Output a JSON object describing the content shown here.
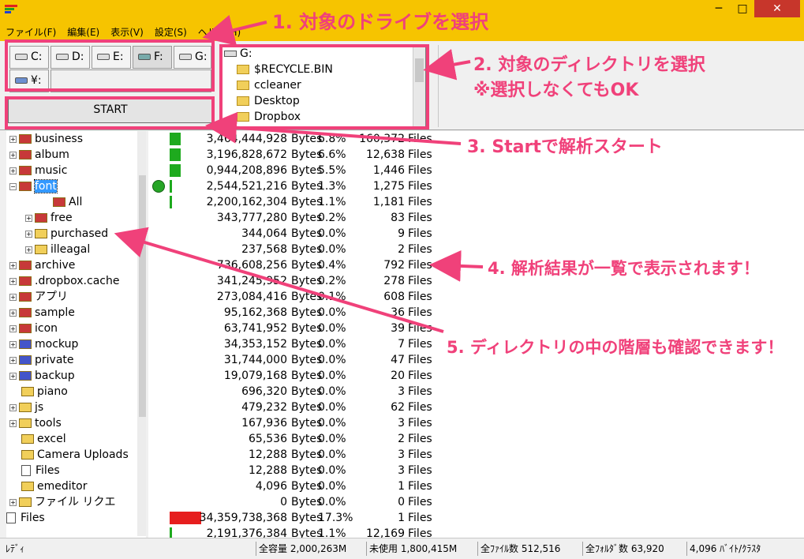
{
  "menu": [
    "ファイル(F)",
    "編集(E)",
    "表示(V)",
    "設定(S)",
    "ヘルプ(H)"
  ],
  "window": {
    "min": "─",
    "max": "□",
    "close": "✕"
  },
  "drives": [
    {
      "label": "C:",
      "icon": "hdd-icon"
    },
    {
      "label": "D:",
      "icon": "hdd-icon"
    },
    {
      "label": "E:",
      "icon": "hdd-icon"
    },
    {
      "label": "F:",
      "icon": "network-drive-icon"
    },
    {
      "label": "G:",
      "icon": "hdd-icon"
    },
    {
      "label": "¥:",
      "icon": "network-computer-icon"
    }
  ],
  "dirs": [
    "G:",
    "$RECYCLE.BIN",
    "ccleaner",
    "Desktop",
    "Dropbox"
  ],
  "start_label": "START",
  "tree": [
    {
      "label": "business",
      "color": "red",
      "depth": 0
    },
    {
      "label": "album",
      "color": "red",
      "depth": 0
    },
    {
      "label": "music",
      "color": "red",
      "depth": 0
    },
    {
      "label": "font",
      "color": "red",
      "depth": 0,
      "selected": true,
      "expanded": true
    },
    {
      "label": "All",
      "color": "red",
      "depth": 2,
      "noexp": true
    },
    {
      "label": "free",
      "color": "red",
      "depth": 1
    },
    {
      "label": "purchased",
      "color": "yel",
      "depth": 1
    },
    {
      "label": "illeagal",
      "color": "yel",
      "depth": 1
    },
    {
      "label": "archive",
      "color": "red",
      "depth": 0
    },
    {
      "label": ".dropbox.cache",
      "color": "red",
      "depth": 0
    },
    {
      "label": "アプリ",
      "color": "red",
      "depth": 0
    },
    {
      "label": "sample",
      "color": "red",
      "depth": 0
    },
    {
      "label": "icon",
      "color": "red",
      "depth": 0
    },
    {
      "label": "mockup",
      "color": "blue",
      "depth": 0
    },
    {
      "label": "private",
      "color": "blue",
      "depth": 0
    },
    {
      "label": "backup",
      "color": "blue",
      "depth": 0
    },
    {
      "label": "piano",
      "color": "yel",
      "depth": 0,
      "noexp": true
    },
    {
      "label": "js",
      "color": "yel",
      "depth": 0
    },
    {
      "label": "tools",
      "color": "yel",
      "depth": 0
    },
    {
      "label": "excel",
      "color": "yel",
      "depth": 0,
      "noexp": true
    },
    {
      "label": "Camera Uploads",
      "color": "yel",
      "depth": 0,
      "noexp": true
    },
    {
      "label": "Files",
      "color": "file",
      "depth": 0,
      "noexp": true
    },
    {
      "label": "emeditor",
      "color": "yel",
      "depth": 0,
      "noexp": true
    },
    {
      "label": "ファイル リクエ",
      "color": "yel",
      "depth": 0
    },
    {
      "label": "Files",
      "color": "file",
      "depth": -1,
      "noexp": true
    }
  ],
  "rows": [
    {
      "bytes": "3,464,444,928",
      "unit": "Bytes",
      "pct": "6.8%",
      "count": "160,372",
      "cunit": "Files"
    },
    {
      "bytes": "3,196,828,672",
      "unit": "Bytes",
      "pct": "6.6%",
      "count": "12,638",
      "cunit": "Files"
    },
    {
      "bytes": "0,944,208,896",
      "unit": "Bytes",
      "pct": "5.5%",
      "count": "1,446",
      "cunit": "Files"
    },
    {
      "bytes": "2,544,521,216",
      "unit": "Bytes",
      "pct": "1.3%",
      "count": "1,275",
      "cunit": "Files"
    },
    {
      "bytes": "2,200,162,304",
      "unit": "Bytes",
      "pct": "1.1%",
      "count": "1,181",
      "cunit": "Files"
    },
    {
      "bytes": "343,777,280",
      "unit": "Bytes",
      "pct": "0.2%",
      "count": "83",
      "cunit": "Files"
    },
    {
      "bytes": "344,064",
      "unit": "Bytes",
      "pct": "0.0%",
      "count": "9",
      "cunit": "Files"
    },
    {
      "bytes": "237,568",
      "unit": "Bytes",
      "pct": "0.0%",
      "count": "2",
      "cunit": "Files"
    },
    {
      "bytes": "736,608,256",
      "unit": "Bytes",
      "pct": "0.4%",
      "count": "792",
      "cunit": "Files"
    },
    {
      "bytes": "341,245,952",
      "unit": "Bytes",
      "pct": "0.2%",
      "count": "278",
      "cunit": "Files"
    },
    {
      "bytes": "273,084,416",
      "unit": "Bytes",
      "pct": "0.1%",
      "count": "608",
      "cunit": "Files"
    },
    {
      "bytes": "95,162,368",
      "unit": "Bytes",
      "pct": "0.0%",
      "count": "36",
      "cunit": "Files"
    },
    {
      "bytes": "63,741,952",
      "unit": "Bytes",
      "pct": "0.0%",
      "count": "39",
      "cunit": "Files"
    },
    {
      "bytes": "34,353,152",
      "unit": "Bytes",
      "pct": "0.0%",
      "count": "7",
      "cunit": "Files"
    },
    {
      "bytes": "31,744,000",
      "unit": "Bytes",
      "pct": "0.0%",
      "count": "47",
      "cunit": "Files"
    },
    {
      "bytes": "19,079,168",
      "unit": "Bytes",
      "pct": "0.0%",
      "count": "20",
      "cunit": "Files"
    },
    {
      "bytes": "696,320",
      "unit": "Bytes",
      "pct": "0.0%",
      "count": "3",
      "cunit": "Files"
    },
    {
      "bytes": "479,232",
      "unit": "Bytes",
      "pct": "0.0%",
      "count": "62",
      "cunit": "Files"
    },
    {
      "bytes": "167,936",
      "unit": "Bytes",
      "pct": "0.0%",
      "count": "3",
      "cunit": "Files"
    },
    {
      "bytes": "65,536",
      "unit": "Bytes",
      "pct": "0.0%",
      "count": "2",
      "cunit": "Files"
    },
    {
      "bytes": "12,288",
      "unit": "Bytes",
      "pct": "0.0%",
      "count": "3",
      "cunit": "Files"
    },
    {
      "bytes": "12,288",
      "unit": "Bytes",
      "pct": "0.0%",
      "count": "3",
      "cunit": "Files"
    },
    {
      "bytes": "4,096",
      "unit": "Bytes",
      "pct": "0.0%",
      "count": "1",
      "cunit": "Files"
    },
    {
      "bytes": "0",
      "unit": "Bytes",
      "pct": "0.0%",
      "count": "0",
      "cunit": "Files"
    },
    {
      "bytes": "34,359,738,368",
      "unit": "Bytes",
      "pct": "17.3%",
      "count": "1",
      "cunit": "Files",
      "red": true
    },
    {
      "bytes": "2,191,376,384",
      "unit": "Bytes",
      "pct": "1.1%",
      "count": "12,169",
      "cunit": "Files"
    }
  ],
  "status": {
    "ready": "ﾚﾃﾞｨ",
    "total": "全容量 2,000,263M",
    "free": "未使用 1,800,415M",
    "files": "全ﾌｧｲﾙ数 512,516",
    "folders": "全ﾌｫﾙﾀﾞ数 63,920",
    "cluster": "4,096 ﾊﾞｲﾄ/ｸﾗｽﾀ"
  },
  "annotations": {
    "a1": "1. 対象のドライブを選択",
    "a2": "2. 対象のディレクトリを選択",
    "a2b": "※選択しなくてもOK",
    "a3": "3. Startで解析スタート",
    "a4": "4. 解析結果が一覧で表示されます！",
    "a5": "5. ディレクトリの中の階層も確認できます！"
  },
  "colors": {
    "accent": "#f0417a",
    "titlebar": "#f6c400",
    "bar_green": "#1eaa1e",
    "bar_red": "#e61e1e"
  }
}
